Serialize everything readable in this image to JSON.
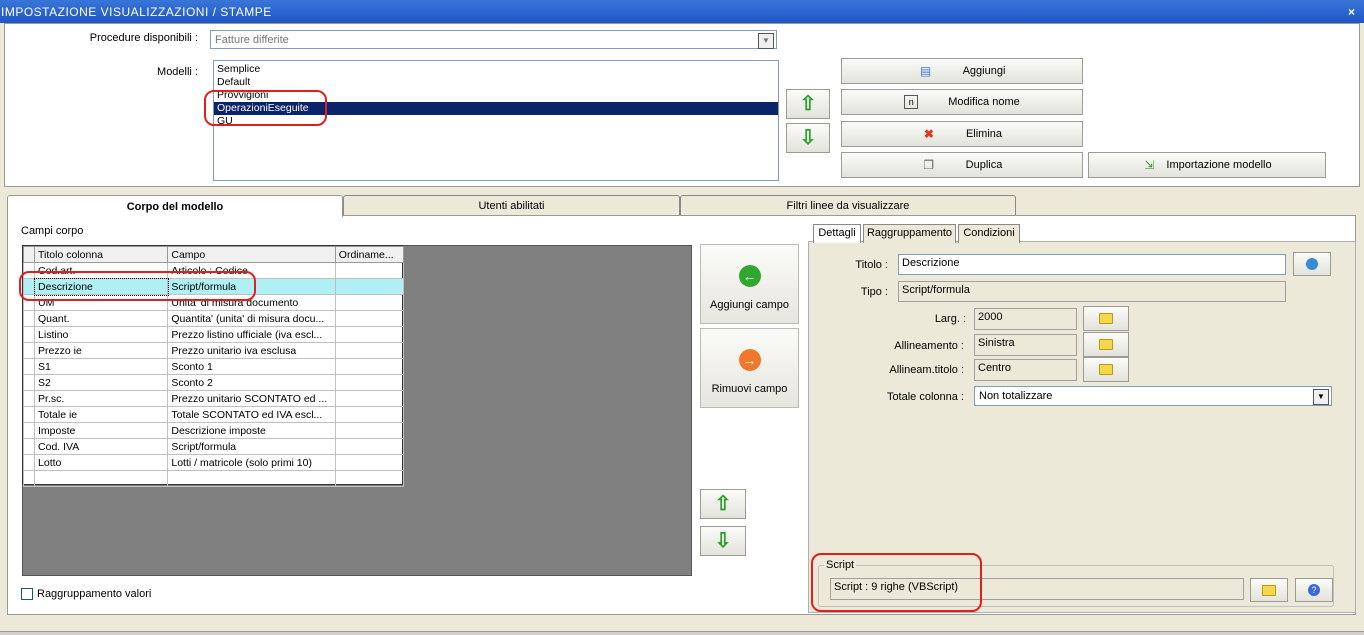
{
  "window": {
    "title": "IMPOSTAZIONE VISUALIZZAZIONI / STAMPE",
    "close_glyph": "×"
  },
  "procedure": {
    "label": "Procedure disponibili :",
    "value": "Fatture differite"
  },
  "modelli": {
    "label": "Modelli :",
    "items": [
      "Semplice",
      "Default",
      "Provvigioni",
      "OperazioniEseguite",
      "GU"
    ],
    "selected_index": 3
  },
  "model_buttons": {
    "aggiungi": "Aggiungi",
    "modifica_nome": "Modifica nome",
    "elimina": "Elimina",
    "duplica": "Duplica",
    "importazione": "Importazione modello"
  },
  "tabs": [
    "Corpo del modello",
    "Utenti abilitati",
    "Filtri linee da visualizzare"
  ],
  "campi_corpo": {
    "label": "Campi corpo",
    "columns": [
      "Titolo colonna",
      "Campo",
      "Ordiname..."
    ],
    "rows": [
      [
        "Cod.art.",
        "Articolo : Codice",
        ""
      ],
      [
        "Descrizione",
        "Script/formula",
        ""
      ],
      [
        "UM",
        "Unita' di misura documento",
        ""
      ],
      [
        "Quant.",
        "Quantita' (unita' di misura docu...",
        ""
      ],
      [
        "Listino",
        "Prezzo listino ufficiale (iva escl...",
        ""
      ],
      [
        "Prezzo ie",
        "Prezzo unitario iva esclusa",
        ""
      ],
      [
        "S1",
        "Sconto 1",
        ""
      ],
      [
        "S2",
        "Sconto 2",
        ""
      ],
      [
        "Pr.sc.",
        "Prezzo unitario SCONTATO ed ...",
        ""
      ],
      [
        "Totale ie",
        "Totale SCONTATO ed IVA escl...",
        ""
      ],
      [
        "Imposte",
        "Descrizione imposte",
        ""
      ],
      [
        "Cod. IVA",
        "Script/formula",
        ""
      ],
      [
        "Lotto",
        "Lotti / matricole (solo primi 10)",
        ""
      ],
      [
        "",
        "",
        ""
      ]
    ],
    "selected_index": 1
  },
  "campo_buttons": {
    "aggiungi": "Aggiungi campo",
    "rimuovi": "Rimuovi campo"
  },
  "raggruppamento_valori": "Raggruppamento valori",
  "subtabs": [
    "Dettagli",
    "Raggruppamento",
    "Condizioni"
  ],
  "dettagli": {
    "titolo_label": "Titolo :",
    "titolo_value": "Descrizione",
    "tipo_label": "Tipo :",
    "tipo_value": "Script/formula",
    "larg_label": "Larg. :",
    "larg_value": "2000",
    "allineamento_label": "Allineamento :",
    "allineamento_value": "Sinistra",
    "allineam_titolo_label": "Allineam.titolo :",
    "allineam_titolo_value": "Centro",
    "totale_label": "Totale colonna :",
    "totale_value": "Non totalizzare"
  },
  "script": {
    "legend": "Script",
    "value": "Script : 9 righe (VBScript)"
  },
  "colors": {
    "titlebar": "#2A66D0",
    "selection": "#0A246A",
    "highlight_row": "#B0F0F5",
    "annotation": "#E02020"
  }
}
